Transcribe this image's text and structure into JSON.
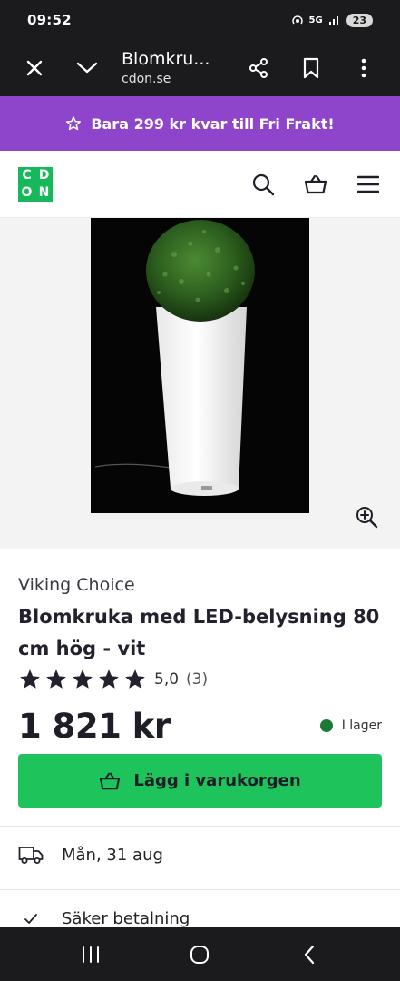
{
  "status_bar": {
    "time": "09:52",
    "network": "5G",
    "battery": "23"
  },
  "browser": {
    "title": "Blomkru...",
    "url": "cdon.se"
  },
  "promo": {
    "text": "Bara 299 kr kvar till Fri Frakt!"
  },
  "logo": {
    "letters": [
      "C",
      "D",
      "O",
      "N"
    ]
  },
  "product": {
    "brand": "Viking Choice",
    "title": "Blomkruka med LED-belysning 80 cm hög - vit",
    "rating": "5,0",
    "rating_count": "(3)",
    "rating_stars": 5,
    "price": "1 821 kr",
    "stock": "I lager",
    "add_to_cart": "Lägg i varukorgen"
  },
  "features": {
    "delivery": "Mån, 31 aug",
    "payment": "Säker betalning"
  },
  "colors": {
    "promo_bg": "#8f44cc",
    "brand_green": "#16b85a",
    "cart_green": "#1fc35c",
    "stock_green": "#1a7a34",
    "dark_bar": "#1b1b1d"
  },
  "icons": {
    "browser": [
      "close-icon",
      "chevron-down-icon",
      "share-icon",
      "bookmark-icon",
      "more-vert-icon"
    ],
    "header": [
      "search-icon",
      "basket-icon",
      "menu-icon"
    ],
    "nav": [
      "recents-icon",
      "home-icon",
      "back-icon"
    ]
  }
}
